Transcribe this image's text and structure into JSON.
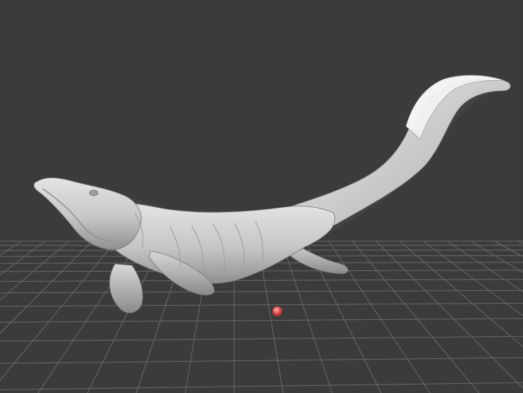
{
  "viewport": {
    "background": "#3b3b3b",
    "grid_color": "#6a6a6a",
    "grid_visible": true
  },
  "model": {
    "subject": "mosasaur sculpt",
    "material": "matcap-grey",
    "base_color": "#cfcfcf",
    "shadow_color": "#7d7d7d",
    "highlight_color": "#f2f2f2"
  },
  "pivot": {
    "icon": "pivot-point-icon",
    "color": "#e0504e"
  }
}
